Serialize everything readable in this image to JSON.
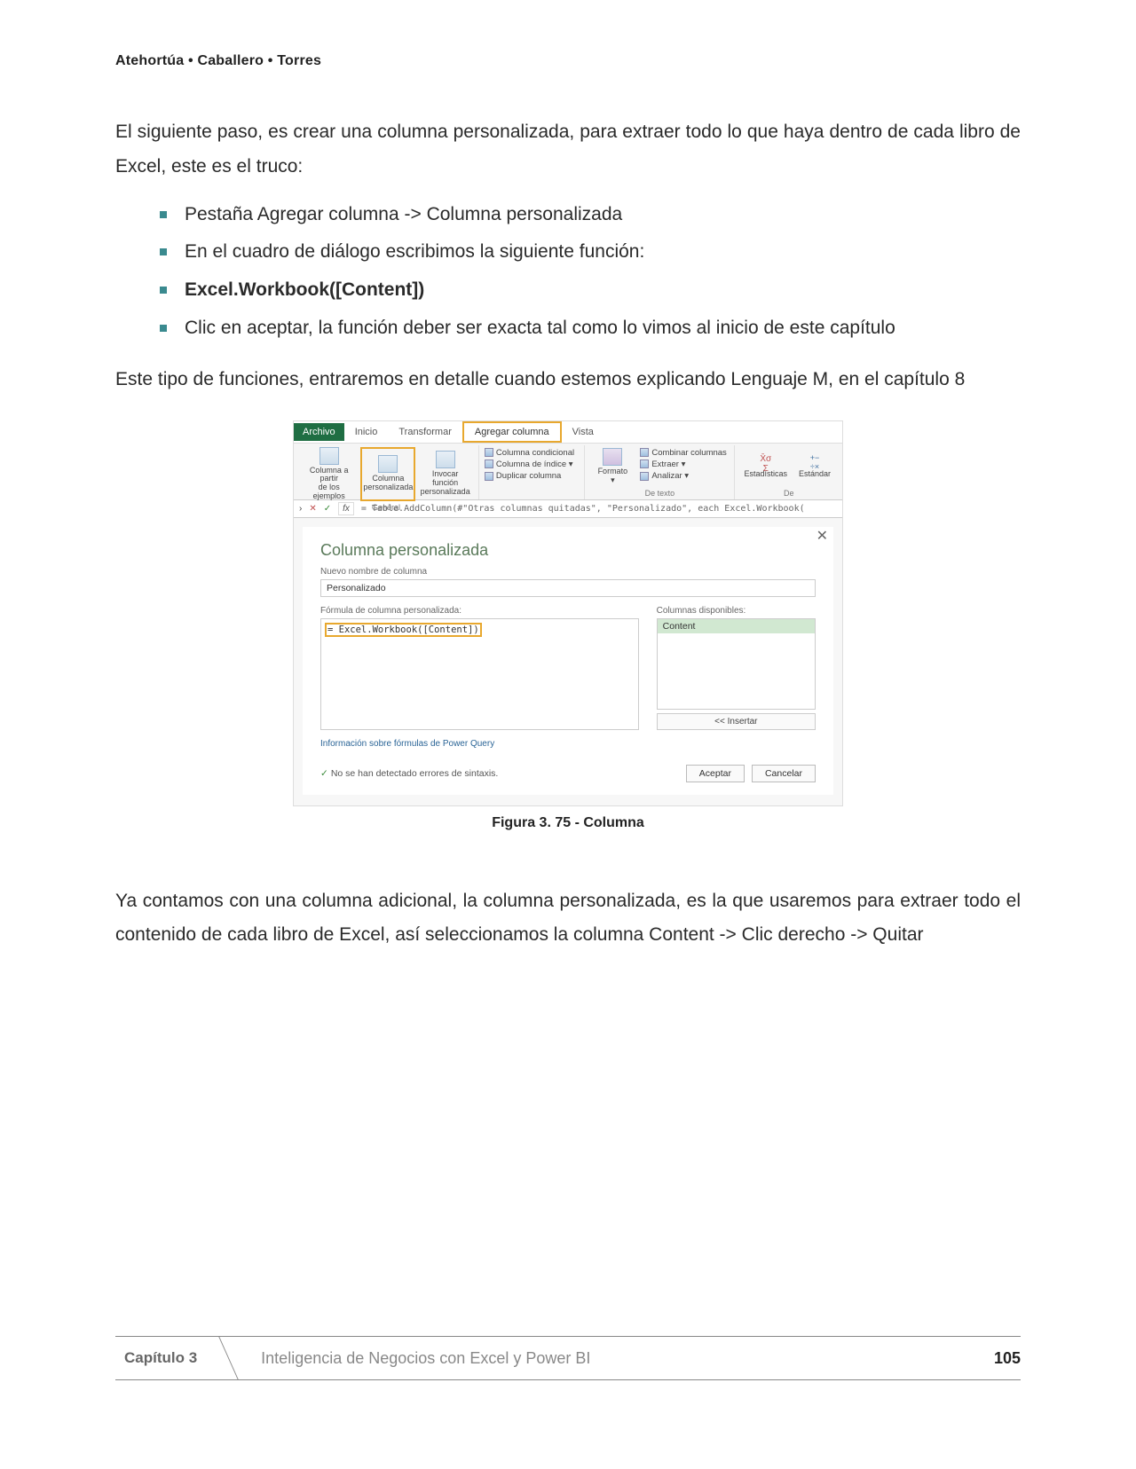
{
  "header": {
    "authors": "Atehortúa • Caballero • Torres"
  },
  "para1": "El siguiente paso, es crear una columna personalizada, para extraer todo lo que haya dentro de cada libro de Excel, este es el truco:",
  "bullets": {
    "b1": "Pestaña Agregar columna -> Columna personalizada",
    "b2": "En el cuadro de diálogo escribimos la siguiente función:",
    "b3": "Excel.Workbook([Content])",
    "b4": "Clic en aceptar, la función deber ser exacta tal como lo vimos al inicio de este capítulo"
  },
  "para2": "Este tipo de funciones, entraremos en detalle cuando estemos explicando Lenguaje M, en el capítulo 8",
  "ribbon": {
    "tabs": {
      "archivo": "Archivo",
      "inicio": "Inicio",
      "transformar": "Transformar",
      "agregar": "Agregar columna",
      "vista": "Vista"
    },
    "buttons": {
      "col_ejemplos_1": "Columna a partir",
      "col_ejemplos_2": "de los ejemplos",
      "col_pers_1": "Columna",
      "col_pers_2": "personalizada",
      "invocar_1": "Invocar función",
      "invocar_2": "personalizada",
      "grp_general": "General",
      "cond": "Columna condicional",
      "indice": "Columna de índice ▾",
      "duplicar": "Duplicar columna",
      "formato": "Formato",
      "formato2": "▾",
      "combinar": "Combinar columnas",
      "extraer": "Extraer ▾",
      "analizar": "Analizar ▾",
      "grp_texto": "De texto",
      "estad": "Estadísticas",
      "estandar": "Estándar",
      "grp_num": "De"
    },
    "formula": "= Table.AddColumn(#\"Otras columnas quitadas\", \"Personalizado\", each Excel.Workbook("
  },
  "dialog": {
    "title": "Columna personalizada",
    "new_name_label": "Nuevo nombre de columna",
    "new_name_value": "Personalizado",
    "formula_label": "Fórmula de columna personalizada:",
    "formula_value": "= Excel.Workbook([Content])",
    "avail_label": "Columnas disponibles:",
    "avail_item": "Content",
    "insert": "<< Insertar",
    "info": "Información sobre fórmulas de Power Query",
    "syntax": "No se han detectado errores de sintaxis.",
    "accept": "Aceptar",
    "cancel": "Cancelar"
  },
  "figure_caption": "Figura 3. 75 - Columna",
  "para3": "Ya contamos con una columna adicional, la columna personalizada, es la que usaremos para extraer todo el contenido de cada libro de Excel, así seleccionamos la columna Content -> Clic derecho -> Quitar",
  "footer": {
    "chapter": "Capítulo 3",
    "title": "Inteligencia de Negocios con Excel y Power BI",
    "page": "105"
  }
}
